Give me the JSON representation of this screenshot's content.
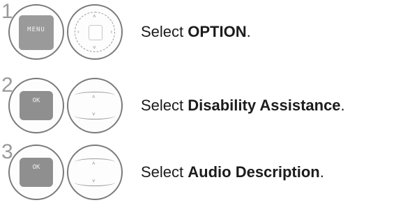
{
  "steps": [
    {
      "number": "1",
      "key_label": "MENU",
      "key_icon": "menu-button",
      "pad_icon": "navigation-pad",
      "prefix": "Select ",
      "target": "OPTION",
      "suffix": "."
    },
    {
      "number": "2",
      "key_label": "OK",
      "key_icon": "ok-button",
      "pad_icon": "up-down-buttons",
      "prefix": "Select ",
      "target": "Disability Assistance",
      "suffix": "."
    },
    {
      "number": "3",
      "key_label": "OK",
      "key_icon": "ok-button",
      "pad_icon": "up-down-buttons",
      "prefix": "Select ",
      "target": "Audio Description",
      "suffix": "."
    }
  ]
}
